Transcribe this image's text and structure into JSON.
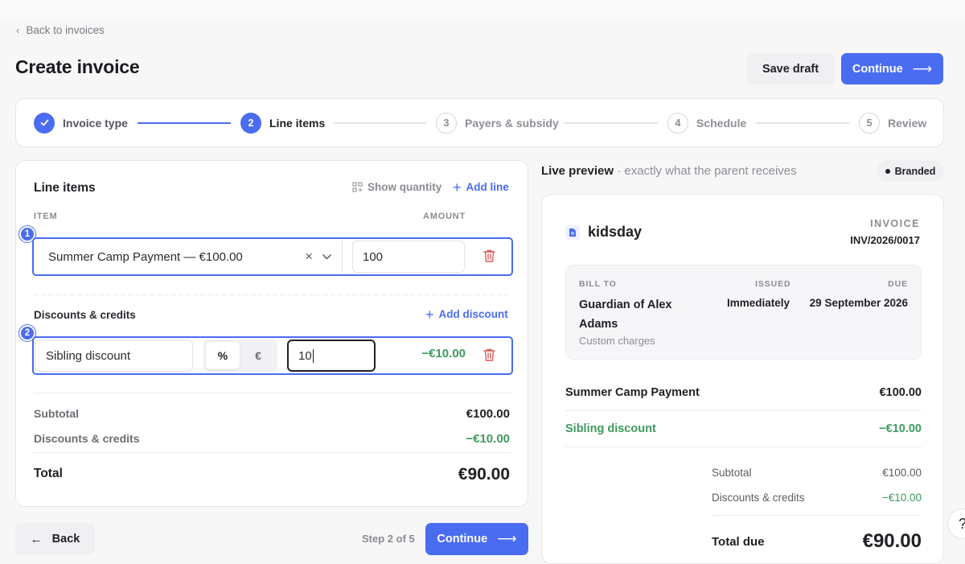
{
  "nav": {
    "back_label": "Back to invoices"
  },
  "page": {
    "title": "Create invoice"
  },
  "header": {
    "save_draft_label": "Save draft",
    "continue_label": "Continue"
  },
  "stepper": {
    "steps": [
      {
        "number": "1",
        "label": "Invoice type",
        "state": "done"
      },
      {
        "number": "2",
        "label": "Line items",
        "state": "active"
      },
      {
        "number": "3",
        "label": "Payers & subsidy",
        "state": "todo"
      },
      {
        "number": "4",
        "label": "Schedule",
        "state": "todo"
      },
      {
        "number": "5",
        "label": "Review",
        "state": "todo"
      }
    ]
  },
  "editor": {
    "title": "Line items",
    "show_quantity_label": "Show quantity",
    "add_line_label": "Add line",
    "columns": {
      "item": "ITEM",
      "amount": "AMOUNT"
    },
    "line_items": [
      {
        "badge": "1",
        "item": "Summer Camp Payment — €100.00",
        "amount": "100"
      }
    ],
    "discounts_title": "Discounts & credits",
    "add_discount_label": "Add discount",
    "discounts": [
      {
        "badge": "2",
        "name": "Sibling discount",
        "type_percent": "%",
        "type_euro": "€",
        "selected_type": "%",
        "value": "10",
        "computed": "−€10.00"
      }
    ],
    "summary": {
      "subtotal_label": "Subtotal",
      "subtotal": "€100.00",
      "discounts_label": "Discounts & credits",
      "discounts": "−€10.00",
      "total_label": "Total",
      "total": "€90.00"
    }
  },
  "footer": {
    "back_label": "Back",
    "step_text": "Step 2 of 5",
    "continue_label": "Continue"
  },
  "preview": {
    "heading": "Live preview",
    "subheading": " · exactly what the parent receives",
    "badge": "Branded",
    "brand": "kidsday",
    "invoice_label": "INVOICE",
    "invoice_number": "INV/2026/0017",
    "bill_to_label": "BILL TO",
    "bill_to": "Guardian of Alex Adams",
    "bill_to_note": "Custom charges",
    "issued_label": "ISSUED",
    "issued": "Immediately",
    "due_label": "DUE",
    "due": "29 September 2026",
    "lines": [
      {
        "label": "Summer Camp Payment",
        "amount": "€100.00"
      },
      {
        "label": "Sibling discount",
        "amount": "−€10.00"
      }
    ],
    "subtotal_label": "Subtotal",
    "subtotal": "€100.00",
    "discounts_label": "Discounts & credits",
    "discounts": "−€10.00",
    "total_due_label": "Total due",
    "total_due": "€90.00"
  },
  "help": {
    "label": "?"
  },
  "colors": {
    "accent": "#4a6cf0",
    "positive_discount": "#3f9a5c",
    "danger": "#e05a5a"
  }
}
